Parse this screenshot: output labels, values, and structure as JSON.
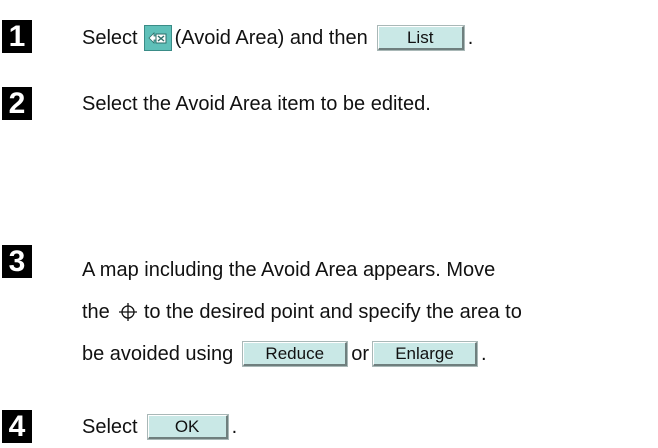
{
  "steps": [
    {
      "number": "1",
      "text_before": "Select",
      "icon": "avoid-area-icon",
      "text_middle": "(Avoid Area) and then",
      "button": "List",
      "text_after": "."
    },
    {
      "number": "2",
      "text": "Select the Avoid Area item to be edited."
    },
    {
      "number": "3",
      "line1": "A map including the Avoid Area appears. Move",
      "line2_before": "the",
      "line2_icon": "crosshair-icon",
      "line2_after": "to the desired point and specify the area to",
      "line3_before": "be avoided using",
      "button_reduce": "Reduce",
      "line3_or": "or",
      "button_enlarge": "Enlarge",
      "line3_after": "."
    },
    {
      "number": "4",
      "text_before": "Select",
      "button": "OK",
      "text_after": "."
    }
  ],
  "colors": {
    "button_fill": "#c9e8e6",
    "icon_fill": "#5fc0b9",
    "step_badge": "#000000"
  }
}
